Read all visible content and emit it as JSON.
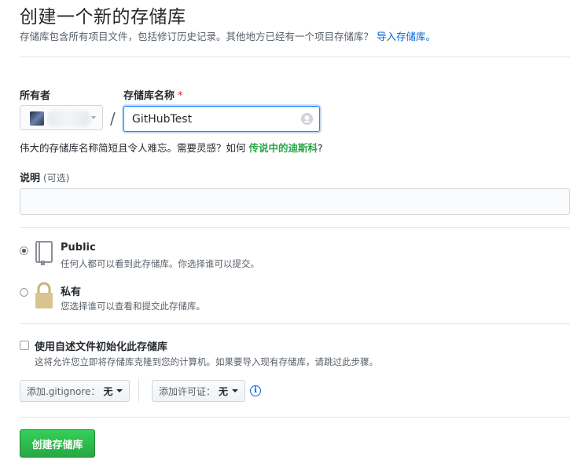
{
  "header": {
    "title": "创建一个新的存储库",
    "subtitle": "存储库包含所有项目文件，包括修订历史记录。其他地方已经有一个项目存储库？",
    "import_link": "导入存储库。"
  },
  "owner": {
    "label": "所有者"
  },
  "repo": {
    "label": "存储库名称",
    "required_mark": "*",
    "value": "GitHubTest",
    "separator": "/"
  },
  "hint": {
    "text": "伟大的存储库名称简短且令人难忘。需要灵感？如何",
    "suggestion": "传说中的迪斯科",
    "suffix": "?"
  },
  "description": {
    "label": "说明",
    "optional": "(可选)",
    "value": ""
  },
  "visibility": {
    "public": {
      "title": "Public",
      "desc": "任何人都可以看到此存储库。你选择谁可以提交。",
      "selected": true
    },
    "private": {
      "title": "私有",
      "desc": "您选择谁可以查看和提交此存储库。",
      "selected": false
    }
  },
  "init": {
    "label": "使用自述文件初始化此存储库",
    "desc": "这将允许您立即将存储库克隆到您的计算机。如果要导入现有存储库，请跳过此步骤。",
    "checked": false
  },
  "gitignore": {
    "label": "添加.gitignore：",
    "value": "无"
  },
  "license": {
    "label": "添加许可证：",
    "value": "无"
  },
  "info_glyph": "i",
  "submit": {
    "label": "创建存储库"
  },
  "colors": {
    "link": "#0366d6",
    "accent_green": "#28a745",
    "required": "#cb2431"
  }
}
